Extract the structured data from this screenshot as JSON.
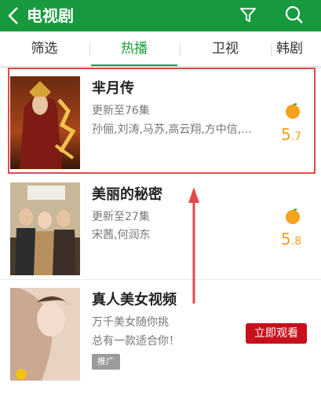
{
  "header": {
    "back_icon": "back-icon",
    "title": "电视剧",
    "filter_icon": "filter-icon",
    "search_icon": "search-icon",
    "bar_color": "#179a3e"
  },
  "tabs": [
    {
      "label": "筛选",
      "active": false
    },
    {
      "label": "热播",
      "active": true
    },
    {
      "label": "卫视",
      "active": false
    },
    {
      "label": "韩剧",
      "active": false
    }
  ],
  "list": [
    {
      "name": "芈月传",
      "update": "更新至76集",
      "cast": "孙俪,刘涛,马苏,高云翔,方中信,...",
      "score_int": "5",
      "score_dec": ".7",
      "score_icon": "orange-fruit-icon"
    },
    {
      "name": "美丽的秘密",
      "update": "更新至27集",
      "cast": "宋茜,何润东",
      "score_int": "5",
      "score_dec": ".8",
      "score_icon": "orange-fruit-icon"
    }
  ],
  "ad": {
    "name": "真人美女视频",
    "line1": "万千美女随你挑",
    "line2": "总有一款适合你！",
    "badge": "推广",
    "cta": "立即观看",
    "cta_color": "#c8101c"
  },
  "annotation": {
    "highlight_color": "#e14a4a",
    "arrow_color": "#e14a4a"
  }
}
